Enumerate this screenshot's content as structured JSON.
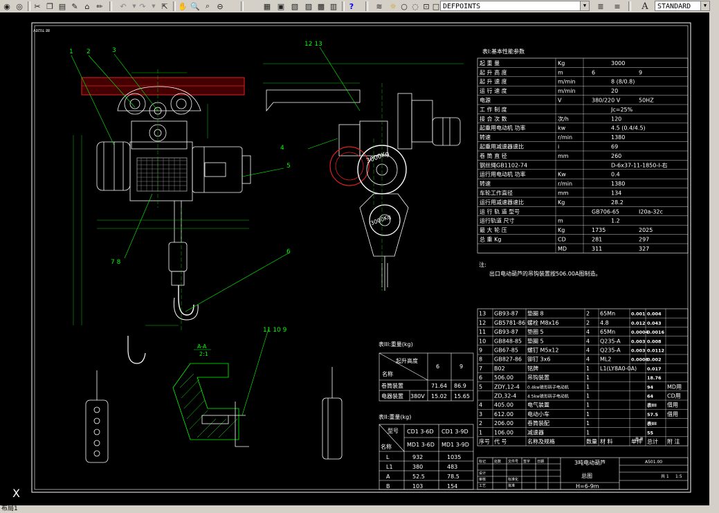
{
  "toolbar": {
    "layer_name": "DEFPOINTS",
    "text_style": "STANDARD"
  },
  "status": {
    "tab": "布局1"
  },
  "drawing": {
    "frame_tag": "8E T02EV",
    "balloons": [
      "1",
      "2",
      "3",
      "4",
      "5",
      "6",
      "7 8",
      "12 13",
      "11 10 9"
    ],
    "section_label": "A-A",
    "section_scale": "2:1",
    "hook_label": "3000Kg",
    "note_title": "注:",
    "note_text": "出口电动葫芦的吊钩装置按506.00A图制造。"
  },
  "table1": {
    "title": "表Ⅰ:基本性能参数",
    "rows": [
      [
        "起 重 量",
        "Kg",
        "3000",
        ""
      ],
      [
        "起 升 高 度",
        "m",
        "6",
        "9"
      ],
      [
        "起 升 速 度",
        "m/min",
        "8 (8/0.8)",
        ""
      ],
      [
        "运 行 速 度",
        "m/min",
        "20",
        ""
      ],
      [
        "电源",
        "V",
        "380/220 V",
        "50HZ"
      ],
      [
        "工 作 制 度",
        "",
        "Jc=25%",
        ""
      ],
      [
        "接 合 次 数",
        "次/h",
        "120",
        ""
      ],
      [
        "起重用电动机 功率",
        "kw",
        "4.5 (0.4/4.5)",
        ""
      ],
      [
        "转速",
        "r/min",
        "1380",
        ""
      ],
      [
        "起重用减速器速比",
        "i",
        "69",
        ""
      ],
      [
        "卷 筒 直 径",
        "mm",
        "260",
        ""
      ],
      [
        "钢丝绳GB1102-74",
        "",
        "D-6x37-11-1850-Ⅰ-右",
        ""
      ],
      [
        "运行用电动机 功率",
        "Kw",
        "0.4",
        ""
      ],
      [
        "转速",
        "r/min",
        "1380",
        ""
      ],
      [
        "车轮工作直径",
        "mm",
        "134",
        ""
      ],
      [
        "运行用减速器速比",
        "Kg",
        "28.2",
        ""
      ],
      [
        "运 行 轨 道 型号",
        "",
        "GB706-65",
        "Ⅰ20a-32c"
      ],
      [
        "运行轨道 尺寸",
        "m",
        "1.2",
        ""
      ],
      [
        "最 大 轮 压",
        "Kg",
        "1735",
        "2025"
      ],
      [
        "总 重 Kg",
        "CD",
        "281",
        "297"
      ],
      [
        "",
        "MD",
        "311",
        "327"
      ]
    ]
  },
  "table3": {
    "title": "表III:重量(kg)",
    "header_lift": "起升高度",
    "header_name": "名称",
    "cols": [
      "6",
      "9"
    ],
    "rows": [
      [
        "卷筒装置",
        "",
        "71.64",
        "86.9"
      ],
      [
        "电器装置",
        "380V",
        "15.02",
        "15.65"
      ]
    ]
  },
  "table2": {
    "title": "表II:重量(kg)",
    "col_a": [
      "CD1 3-6D",
      "MD1 3-6D"
    ],
    "col_b": [
      "CD1 3-9D",
      "MD1 3-9D"
    ],
    "head_model": "型号",
    "head_name": "名称",
    "rows": [
      [
        "L",
        "932",
        "1035"
      ],
      [
        "L1",
        "380",
        "483"
      ],
      [
        "A",
        "52.5",
        "78.5"
      ],
      [
        "B",
        "103",
        "154"
      ]
    ]
  },
  "bom": {
    "rows": [
      [
        "13",
        "GB93-87",
        "垫圈 8",
        "2",
        "65Mn",
        "0.001",
        "0.004",
        ""
      ],
      [
        "12",
        "GB5781-86",
        "螺栓 M8x16",
        "2",
        "4.8",
        "0.012",
        "0.043",
        ""
      ],
      [
        "11",
        "GB93-87",
        "垫圈 5",
        "4",
        "65Mn",
        "0.0004",
        "0.0016",
        ""
      ],
      [
        "10",
        "GB848-85",
        "垫圈 5",
        "4",
        "Q235-A",
        "0.003",
        "0.008",
        ""
      ],
      [
        "9",
        "GB67-85",
        "螺钉 M5x12",
        "4",
        "Q235-A",
        "0.003",
        "0.0112",
        ""
      ],
      [
        "8",
        "GB827-86",
        "铆钉 3x6",
        "4",
        "ML2",
        "0.0006",
        "0.002",
        ""
      ],
      [
        "7",
        "B02",
        "铭牌",
        "1",
        "L1(LY8A0-0A)",
        "",
        "0.017",
        ""
      ],
      [
        "6",
        "506.00",
        "吊钩装置",
        "1",
        "",
        "",
        "18.76",
        ""
      ],
      [
        "5",
        "ZDY,12-4",
        "0.4kw锥形转子电动机",
        "1",
        "",
        "",
        "94",
        "MD用"
      ],
      [
        "",
        "ZD,32-4",
        "4.5kw锥形转子电动机",
        "1",
        "",
        "",
        "64",
        "CD用"
      ],
      [
        "4",
        "405.00",
        "电气装置",
        "1",
        "",
        "",
        "表III",
        "借用"
      ],
      [
        "3",
        "612.00",
        "电动小车",
        "1",
        "",
        "",
        "57.5",
        "借用"
      ],
      [
        "2",
        "206.00",
        "卷筒装配",
        "1",
        "",
        "",
        "表III",
        ""
      ],
      [
        "1",
        "106.00",
        "减速器",
        "1",
        "",
        "",
        "55",
        ""
      ]
    ],
    "header": [
      "序号",
      "代 号",
      "名称及规格",
      "数量",
      "材 料",
      "单件",
      "总计",
      "附 注"
    ],
    "header_mass": "重 量"
  },
  "titleblock": {
    "product": "3吨电动葫芦",
    "drawing": "总图",
    "model": "H=6-9m",
    "code": "A501.00",
    "scale": "1:5",
    "sheet": "共 1",
    "labels": [
      "标记",
      "处数",
      "文件号",
      "签字",
      "日期",
      "设计",
      "审核",
      "工艺",
      "标准化",
      "批准"
    ]
  }
}
